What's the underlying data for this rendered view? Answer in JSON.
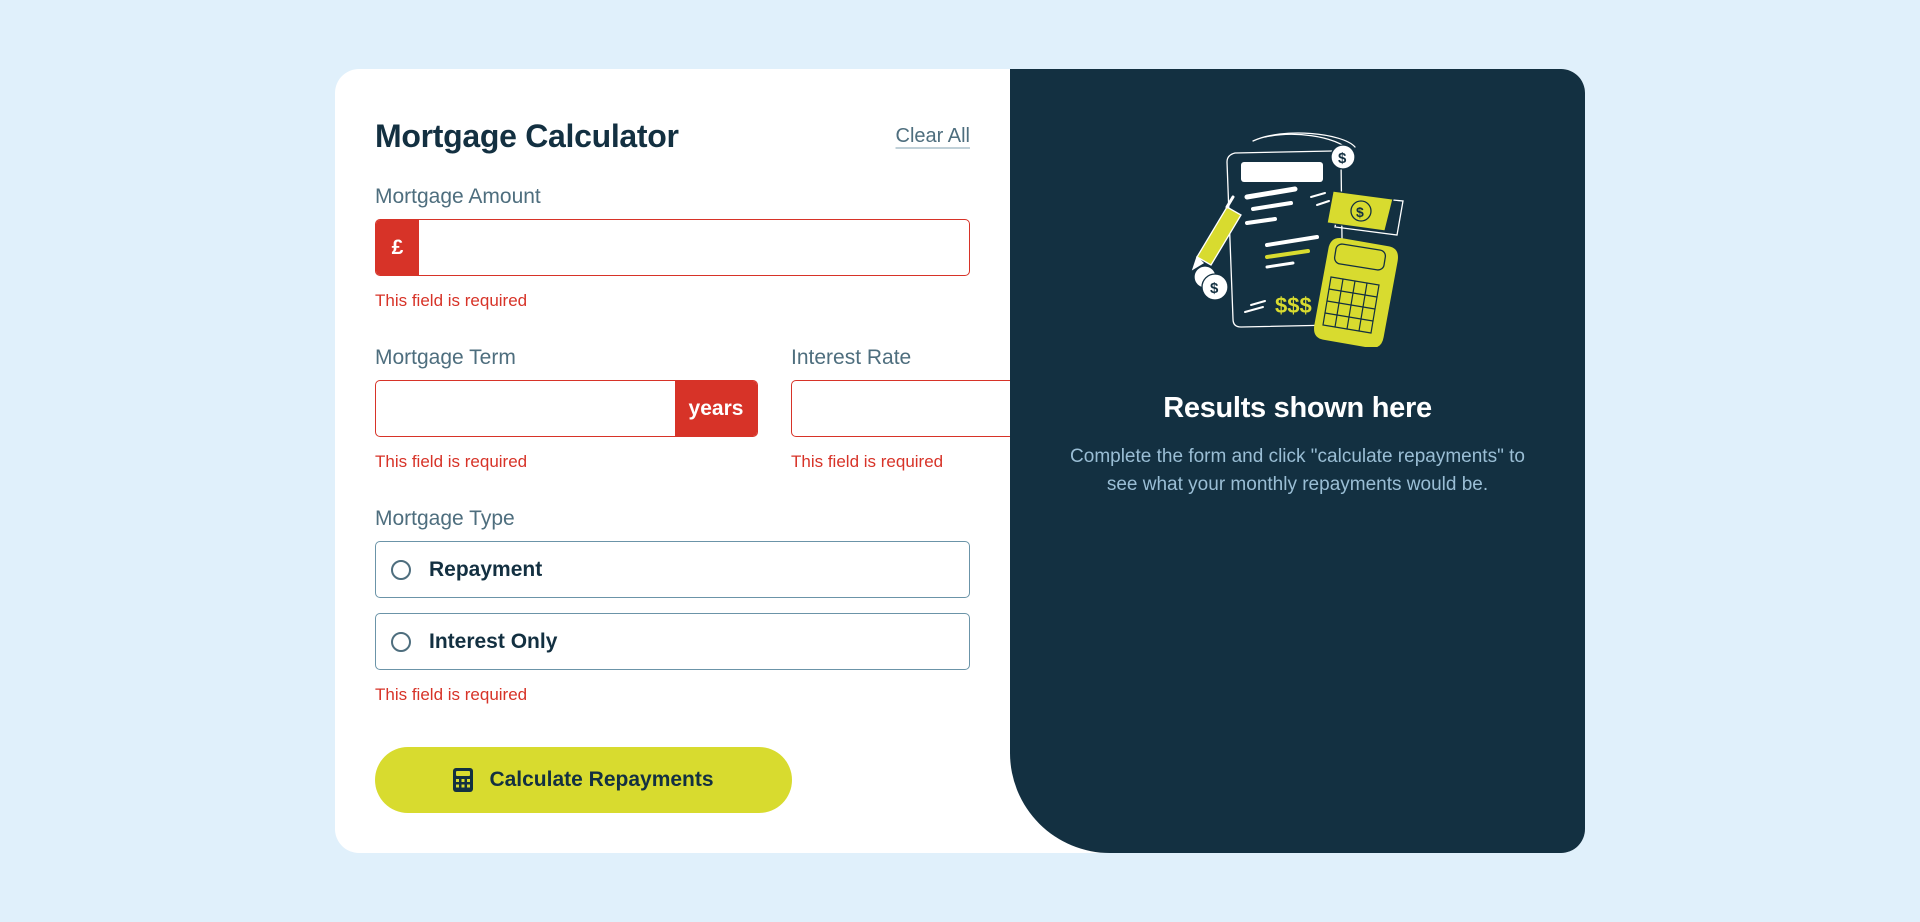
{
  "form": {
    "title": "Mortgage Calculator",
    "clear_label": "Clear All",
    "amount": {
      "label": "Mortgage Amount",
      "prefix": "£",
      "value": "",
      "error": "This field is required"
    },
    "term": {
      "label": "Mortgage Term",
      "suffix": "years",
      "value": "",
      "error": "This field is required"
    },
    "rate": {
      "label": "Interest Rate",
      "suffix": "%",
      "value": "",
      "error": "This field is required"
    },
    "type": {
      "label": "Mortgage Type",
      "options": [
        {
          "label": "Repayment",
          "selected": false
        },
        {
          "label": "Interest Only",
          "selected": false
        }
      ],
      "error": "This field is required"
    },
    "submit_label": "Calculate Repayments"
  },
  "results": {
    "title": "Results shown here",
    "text": "Complete the form and click \"calculate repayments\" to see what your monthly repayments would be."
  },
  "colors": {
    "background": "#e0f0fb",
    "dark": "#133041",
    "lime": "#d8db2f",
    "error": "#d73328",
    "slate": "#4e6e7e"
  },
  "icons": {
    "submit": "calculator-icon",
    "illustration": "empty-results-illustration"
  }
}
